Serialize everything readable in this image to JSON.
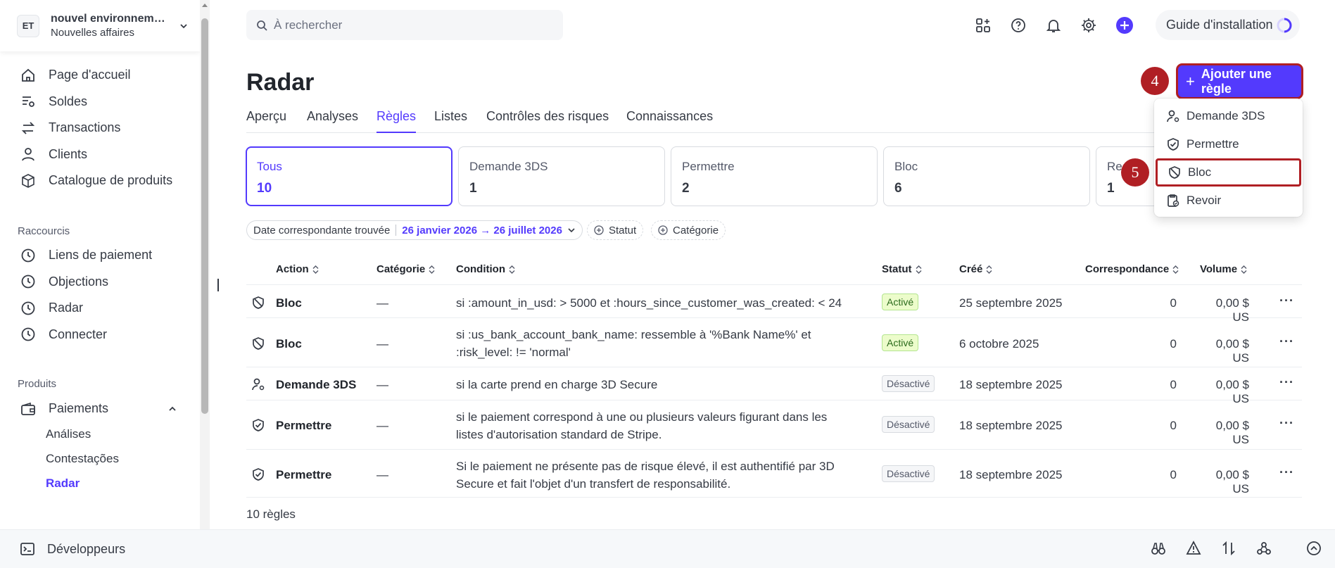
{
  "account": {
    "initials": "ET",
    "name": "nouvel environnemen...",
    "subtitle": "Nouvelles affaires"
  },
  "nav": {
    "main": [
      "Page d'accueil",
      "Soldes",
      "Transactions",
      "Clients",
      "Catalogue de produits"
    ],
    "shortcuts_title": "Raccourcis",
    "shortcuts": [
      "Liens de paiement",
      "Objections",
      "Radar",
      "Connecter"
    ],
    "products_title": "Produits",
    "payments": "Paiements",
    "payments_sub": [
      "Análises",
      "Contestações",
      "Radar"
    ]
  },
  "bottom": {
    "developers": "Développeurs"
  },
  "header": {
    "search_placeholder": "À rechercher",
    "guide": "Guide d'installation"
  },
  "page": {
    "title": "Radar",
    "add_rule": "Ajouter une règle"
  },
  "tabs": [
    "Aperçu",
    "Analyses",
    "Règles",
    "Listes",
    "Contrôles des risques",
    "Connaissances"
  ],
  "active_tab": "Règles",
  "cards": [
    {
      "label": "Tous",
      "count": "10"
    },
    {
      "label": "Demande 3DS",
      "count": "1"
    },
    {
      "label": "Permettre",
      "count": "2"
    },
    {
      "label": "Bloc",
      "count": "6"
    },
    {
      "label": "Re",
      "count": "1"
    }
  ],
  "filters": {
    "date_label": "Date correspondante trouvée",
    "date_value": "26 janvier 2026 → 26 juillet 2026",
    "status": "Statut",
    "category": "Catégorie"
  },
  "table": {
    "headers": [
      "Action",
      "Catégorie",
      "Condition",
      "Statut",
      "Créé",
      "Correspondance",
      "Volume"
    ],
    "rows": [
      {
        "action": "Bloc",
        "category": "—",
        "condition1": "si :amount_in_usd: > 5000 et :hours_since_customer_was_created: < 24",
        "condition2": "",
        "status": "Activé",
        "created": "25 septembre 2025",
        "matches": "0",
        "volume": "0,00 $ US"
      },
      {
        "action": "Bloc",
        "category": "—",
        "condition1": "si :us_bank_account_bank_name: ressemble à '%Bank Name%' et",
        "condition2": ":risk_level: != 'normal'",
        "status": "Activé",
        "created": "6 octobre 2025",
        "matches": "0",
        "volume": "0,00 $ US"
      },
      {
        "action": "Demande 3DS",
        "category": "—",
        "condition1": "si la carte prend en charge 3D Secure",
        "condition2": "",
        "status": "Désactivé",
        "created": "18 septembre 2025",
        "matches": "0",
        "volume": "0,00 $ US"
      },
      {
        "action": "Permettre",
        "category": "—",
        "condition1": "si le paiement correspond à une ou plusieurs valeurs figurant dans les",
        "condition2": "listes d'autorisation standard de Stripe.",
        "status": "Désactivé",
        "created": "18 septembre 2025",
        "matches": "0",
        "volume": "0,00 $ US"
      },
      {
        "action": "Permettre",
        "category": "—",
        "condition1": "Si le paiement ne présente pas de risque élevé, il est authentifié par 3D",
        "condition2": "Secure et fait l'objet d'un transfert de responsabilité.",
        "status": "Désactivé",
        "created": "18 septembre 2025",
        "matches": "0",
        "volume": "0,00 $ US"
      }
    ],
    "footer": "10 règles",
    "more": "···"
  },
  "dropdown": [
    "Demande 3DS",
    "Permettre",
    "Bloc",
    "Revoir"
  ],
  "steps": {
    "add": "4",
    "block": "5"
  },
  "colors": {
    "accent": "#533afd",
    "highlight": "#b01f24"
  }
}
